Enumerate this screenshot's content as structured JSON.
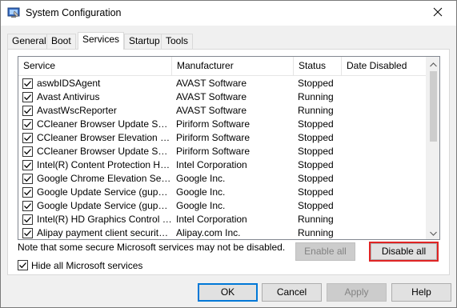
{
  "window": {
    "title": "System Configuration",
    "icon": "system-configuration-icon"
  },
  "tabs": [
    {
      "label": "General",
      "active": false
    },
    {
      "label": "Boot",
      "active": false
    },
    {
      "label": "Services",
      "active": true
    },
    {
      "label": "Startup",
      "active": false
    },
    {
      "label": "Tools",
      "active": false
    }
  ],
  "services_table": {
    "columns": [
      "Service",
      "Manufacturer",
      "Status",
      "Date Disabled"
    ],
    "rows": [
      {
        "checked": true,
        "service": "aswbIDSAgent",
        "manufacturer": "AVAST Software",
        "status": "Stopped",
        "date_disabled": ""
      },
      {
        "checked": true,
        "service": "Avast Antivirus",
        "manufacturer": "AVAST Software",
        "status": "Running",
        "date_disabled": ""
      },
      {
        "checked": true,
        "service": "AvastWscReporter",
        "manufacturer": "AVAST Software",
        "status": "Running",
        "date_disabled": ""
      },
      {
        "checked": true,
        "service": "CCleaner Browser Update Servic...",
        "manufacturer": "Piriform Software",
        "status": "Stopped",
        "date_disabled": ""
      },
      {
        "checked": true,
        "service": "CCleaner Browser Elevation Ser...",
        "manufacturer": "Piriform Software",
        "status": "Stopped",
        "date_disabled": ""
      },
      {
        "checked": true,
        "service": "CCleaner Browser Update Servic...",
        "manufacturer": "Piriform Software",
        "status": "Stopped",
        "date_disabled": ""
      },
      {
        "checked": true,
        "service": "Intel(R) Content Protection HEC...",
        "manufacturer": "Intel Corporation",
        "status": "Stopped",
        "date_disabled": ""
      },
      {
        "checked": true,
        "service": "Google Chrome Elevation Service",
        "manufacturer": "Google Inc.",
        "status": "Stopped",
        "date_disabled": ""
      },
      {
        "checked": true,
        "service": "Google Update Service (gupdate)",
        "manufacturer": "Google Inc.",
        "status": "Stopped",
        "date_disabled": ""
      },
      {
        "checked": true,
        "service": "Google Update Service (gupdatem)",
        "manufacturer": "Google Inc.",
        "status": "Stopped",
        "date_disabled": ""
      },
      {
        "checked": true,
        "service": "Intel(R) HD Graphics Control Pa...",
        "manufacturer": "Intel Corporation",
        "status": "Running",
        "date_disabled": ""
      },
      {
        "checked": true,
        "service": "Alipay payment client security s...",
        "manufacturer": "Alipay.com Inc.",
        "status": "Running",
        "date_disabled": ""
      }
    ]
  },
  "note": "Note that some secure Microsoft services may not be disabled.",
  "buttons": {
    "enable_all": "Enable all",
    "disable_all": "Disable all",
    "ok": "OK",
    "cancel": "Cancel",
    "apply": "Apply",
    "help": "Help"
  },
  "hide_microsoft": {
    "label": "Hide all Microsoft services",
    "checked": true
  },
  "colors": {
    "highlight_border": "#e02424",
    "default_button_border": "#0078d7"
  }
}
